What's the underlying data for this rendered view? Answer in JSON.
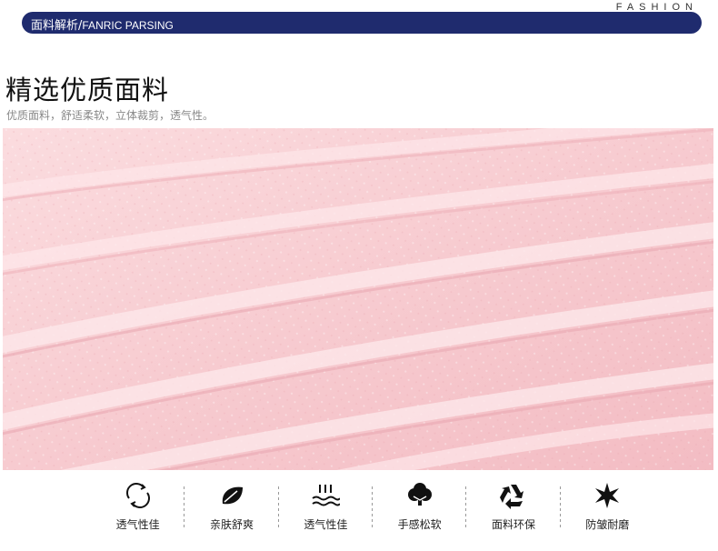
{
  "header": {
    "fashion_label": "FASHION",
    "banner_title_cn": "面料解析/",
    "banner_title_en": "FANRIC PARSING"
  },
  "section": {
    "title": "精选优质面料",
    "subtitle": "优质面料，舒适柔软，立体裁剪，透气性。"
  },
  "fabric": {
    "color": "#f7c9cf",
    "image": "pink-ribbed-knit-fabric"
  },
  "features": [
    {
      "label": "透气性佳",
      "icon": "breathable-swirl-icon"
    },
    {
      "label": "亲肤舒爽",
      "icon": "leaf-icon"
    },
    {
      "label": "透气性佳",
      "icon": "steam-waves-icon"
    },
    {
      "label": "手感松软",
      "icon": "cloud-tree-icon"
    },
    {
      "label": "面料环保",
      "icon": "recycle-icon"
    },
    {
      "label": "防皱耐磨",
      "icon": "star-burst-icon"
    }
  ],
  "colors": {
    "banner": "#1f2b6e",
    "fabric_pink": "#f7c9cf"
  }
}
